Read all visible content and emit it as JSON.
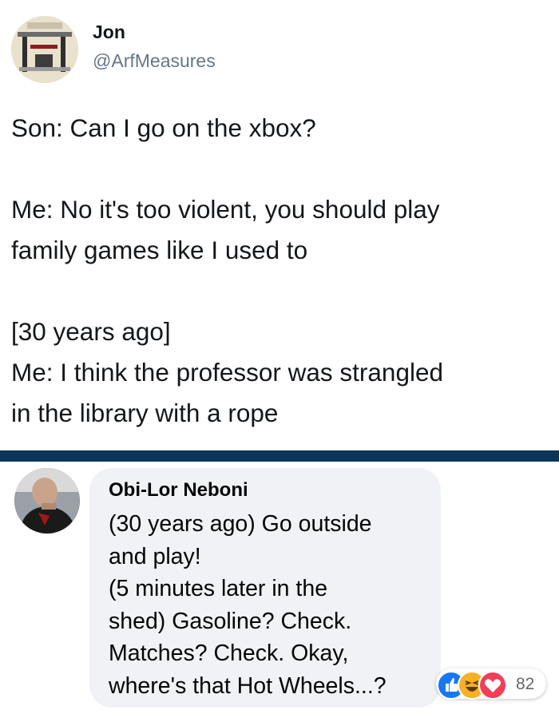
{
  "tweet": {
    "author_name": "Jon",
    "author_handle": "@ArfMeasures",
    "lines": [
      "Son: Can I go on the xbox?",
      "",
      "Me: No it's too violent, you should play",
      "family games like I used to",
      "",
      "[30 years ago]",
      "Me: I think the professor was strangled",
      "in the library with a rope"
    ]
  },
  "comment": {
    "author_name": "Obi-Lor Neboni",
    "lines": [
      "(30 years ago) Go outside",
      "and play!",
      "(5 minutes later in the",
      "shed) Gasoline? Check.",
      "Matches? Check. Okay,",
      "where's that Hot Wheels...?"
    ],
    "reactions": {
      "icons": [
        "like-icon",
        "haha-icon",
        "love-icon"
      ],
      "count": "82"
    }
  },
  "colors": {
    "divider": "#0d3557",
    "handle": "#657786",
    "bubble": "#f0f2f5",
    "like": "#1877f2",
    "haha": "#f7b125",
    "love": "#f33e58"
  }
}
